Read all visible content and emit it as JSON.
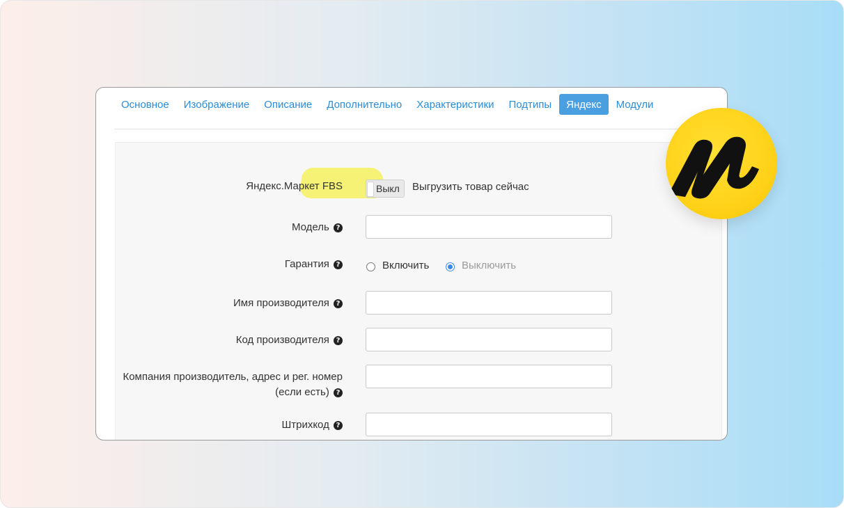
{
  "tabs": [
    {
      "label": "Основное",
      "active": false
    },
    {
      "label": "Изображение",
      "active": false
    },
    {
      "label": "Описание",
      "active": false
    },
    {
      "label": "Дополнительно",
      "active": false
    },
    {
      "label": "Характеристики",
      "active": false
    },
    {
      "label": "Подтипы",
      "active": false
    },
    {
      "label": "Яндекс",
      "active": true
    },
    {
      "label": "Модули",
      "active": false
    }
  ],
  "form": {
    "fbs": {
      "label": "Яндекс.Маркет FBS",
      "toggle_state": "Выкл",
      "caption": "Выгрузить товар сейчас"
    },
    "model": {
      "label": "Модель",
      "value": ""
    },
    "warranty": {
      "label": "Гарантия",
      "options": [
        "Включить",
        "Выключить"
      ],
      "selected": "Выключить"
    },
    "manufacturer_name": {
      "label": "Имя производителя",
      "value": ""
    },
    "manufacturer_code": {
      "label": "Код производителя",
      "value": ""
    },
    "manufacturer_company": {
      "label": "Компания производитель, адрес и рег. номер (если есть)",
      "value": ""
    },
    "barcode": {
      "label": "Штрихкод",
      "value": ""
    }
  },
  "help_icon": "question-circle-icon",
  "logo": "yandex-market-logo",
  "colors": {
    "accent": "#4a9fe0",
    "tab_text": "#2b8cd6",
    "highlight": "#f4f04a",
    "logo_yellow": "#ffd21a"
  }
}
